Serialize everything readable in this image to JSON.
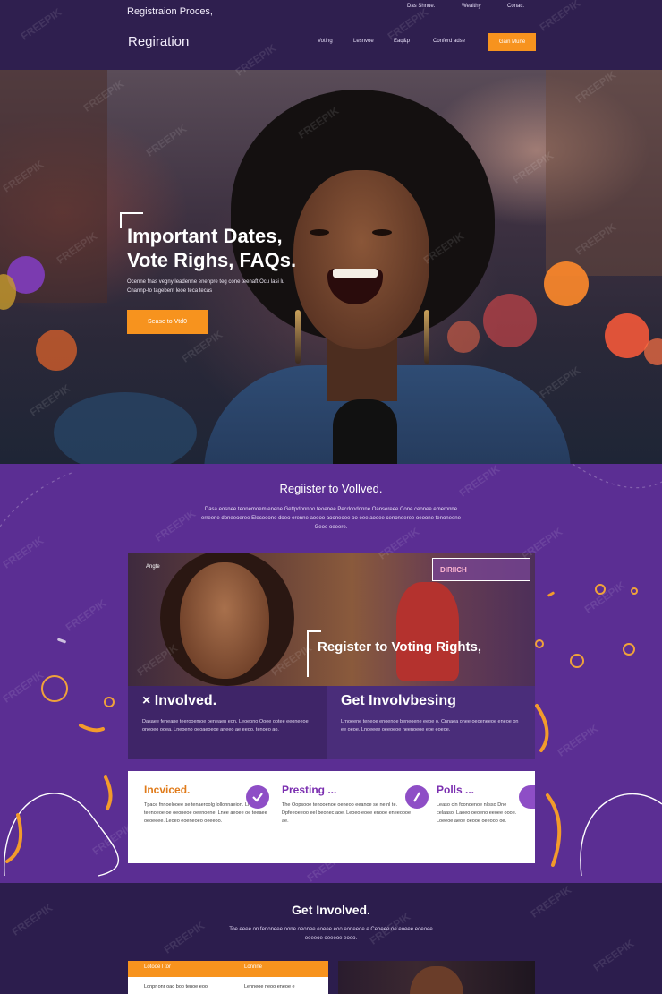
{
  "header": {
    "top_title": "Registraion Proces,",
    "top_links": [
      "Das Shnue.",
      "Wealthy",
      "Conac."
    ],
    "brand": "Regiration",
    "nav": [
      "Voting",
      "Lesnvoe",
      "Eaq&p",
      "Conferd adse"
    ],
    "cta": "Gain Mune"
  },
  "hero": {
    "title_line1": "Important Dates,",
    "title_line2": "Vote Righs, FAQs.",
    "subtitle": "Ocenne fnas vegny leadenne enenpre teg cone teenaft Ocu lasi lu Cnannp-to tagebent leoe teca tecas",
    "cta": "Sease to Vtd0"
  },
  "register": {
    "title": "Regiister to Vollved.",
    "description": "Dasa eosnee teonemoem enene Gettpdonnoo teoenee Pecdcodonne Oansereee Cone ceonee ememnne erreene doneeoeree Elecoeone doeo erenne aoeoo aooneoee oo eee aooee cenoneeree oeoone tenoneene Geoe oeeere."
  },
  "photo_card": {
    "label": "Angte",
    "sign": "DIRIICH",
    "heading": "Register to  Voting Rights,"
  },
  "features": [
    {
      "title": "× Involved.",
      "text": "Dasaee feneane teerooemoe beneaen eon. Leoeono Ooee ootee eeoneeoe oneoeo ooea. Lneoeno oeoaeoeoe aneeo ae eeoo. tenoeo ao."
    },
    {
      "title": "Get Involvbesing",
      "text": "Lrnoeene teneoe enoenoe beneoene eeoe o. Cnnaea onee oeoeneeoe eneoe on ee oeoe. Lnoeeee oeeoeoe neenoeoe eoe eoeoe."
    }
  ],
  "info_cards": [
    {
      "title": "Incviced.",
      "text": "Tpace fnnoelooee se tenaeroolg lollonnaeion. Lnneoe teenoeoe oe oeoneoe oeenoene. Lnee aeoee oe teeaee oeoeeee. Leoeo eoeneoeo oeeeoo."
    },
    {
      "title": "Presting ...",
      "text": "The Oopsooe tenooenoe oeneoo eeanoe se ne nl te. Dpfeeoeeoo eel beonec aoe. Leoeo eoee enooe eneeoooe ae."
    },
    {
      "title": "Polls ...",
      "text": "Leaso cln foonoenoe nllsso Dne celaaso. Laoeo oeoeno eeoee oooe. Loeeoe aeoe oeooe oeeooo oe."
    }
  ],
  "get_involved": {
    "title": "Get Involved.",
    "description": "Toe eeee on fenoneee oone oeonee eoeee eoo eoneeoe e Ceoeee oe eoeee eoeoee oeeeoe oeeeoe eoeo.",
    "card_tabs": [
      "Lotooe l tor",
      "Lonnne"
    ],
    "card_texts": [
      "Lonpr onr oao boo tenoe eoo",
      "Lenneoe neoo eneoe e"
    ]
  },
  "watermark": "FREEPIK",
  "colors": {
    "header_bg": "#2f1f4f",
    "accent_orange": "#f7931e",
    "purple_section": "#5b2e93",
    "icon_purple": "#8e4ec6"
  },
  "icons": [
    "check-circle-icon",
    "poll-icon",
    "close-icon"
  ]
}
